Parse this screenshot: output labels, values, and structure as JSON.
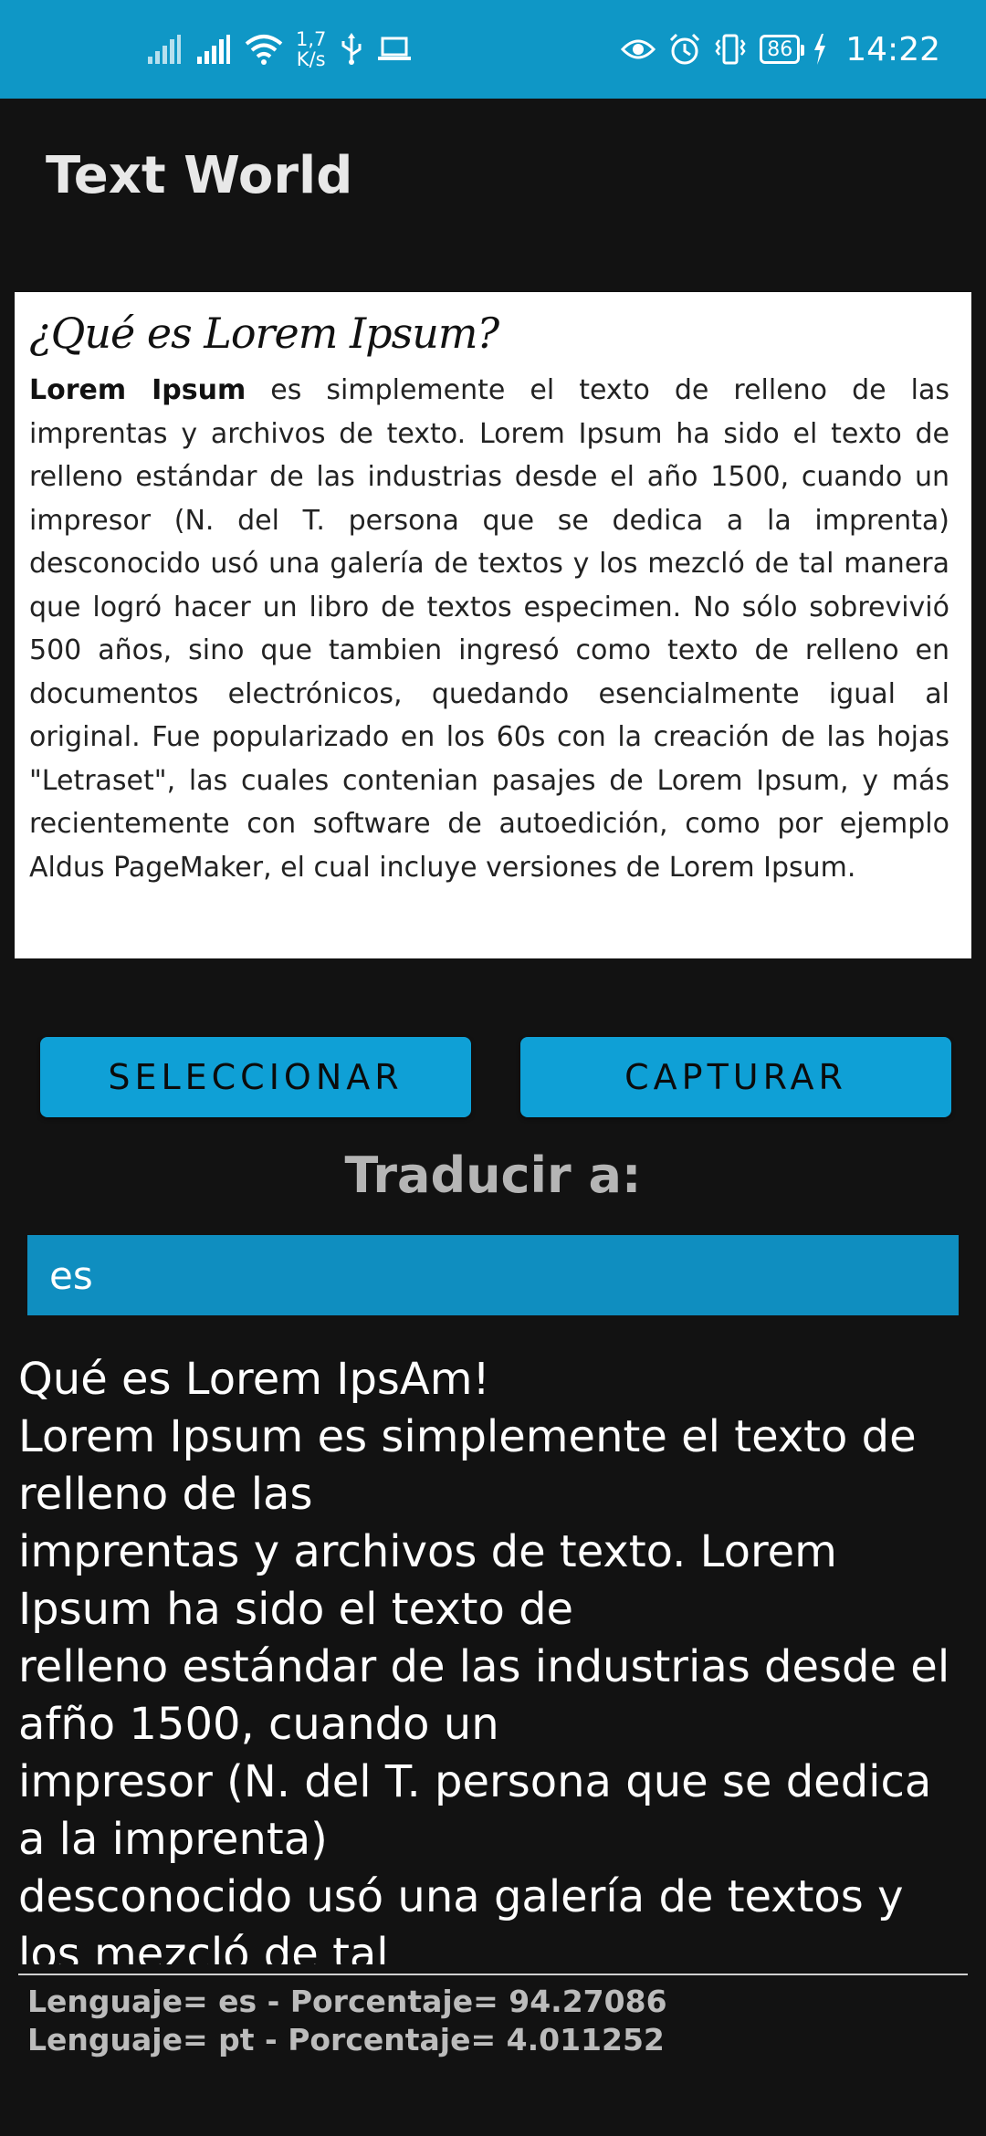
{
  "status_bar": {
    "net_speed_value": "1,7",
    "net_speed_unit": "K/s",
    "battery": "86",
    "time": "14:22",
    "color": "#0f97c6"
  },
  "app": {
    "title": "Text World"
  },
  "image_card": {
    "heading": "¿Qué es Lorem Ipsum?",
    "body_bold": "Lorem Ipsum",
    "body_rest": " es simplemente el texto de relleno de las imprentas y archivos de texto. Lorem Ipsum ha sido el texto de relleno estándar de las industrias desde el año 1500, cuando un impresor (N. del T. persona que se dedica a la imprenta) desconocido usó una galería de textos y los mezcló de tal manera que logró hacer un libro de textos especimen. No sólo sobrevivió 500 años, sino que tambien ingresó como texto de relleno en documentos electrónicos, quedando esencialmente igual al original. Fue popularizado en los 60s con la creación de las hojas \"Letraset\", las cuales contenian pasajes de Lorem Ipsum, y más recientemente con software de autoedición, como por ejemplo Aldus PageMaker, el cual incluye versiones de Lorem Ipsum."
  },
  "buttons": {
    "select_label": "SELECCIONAR",
    "capture_label": "CAPTURAR",
    "color": "#0fa0d6"
  },
  "translate": {
    "label": "Traducir a:",
    "language_value": "es"
  },
  "result": {
    "text": "Qué es Lorem IpsAm!\nLorem Ipsum es simplemente el texto de relleno de las\nimprentas y archivos de texto. Lorem Ipsum ha sido el texto de\nrelleno estándar de las industrias desde el afño 1500, cuando un\nimpresor (N. del T. persona que se dedica a la imprenta)\ndesconocido usó una galería de textos y los mezcló de tal"
  },
  "detection": {
    "line1": "Lenguaje= es - Porcentaje= 94.27086",
    "line2": "Lenguaje= pt - Porcentaje= 4.011252"
  }
}
